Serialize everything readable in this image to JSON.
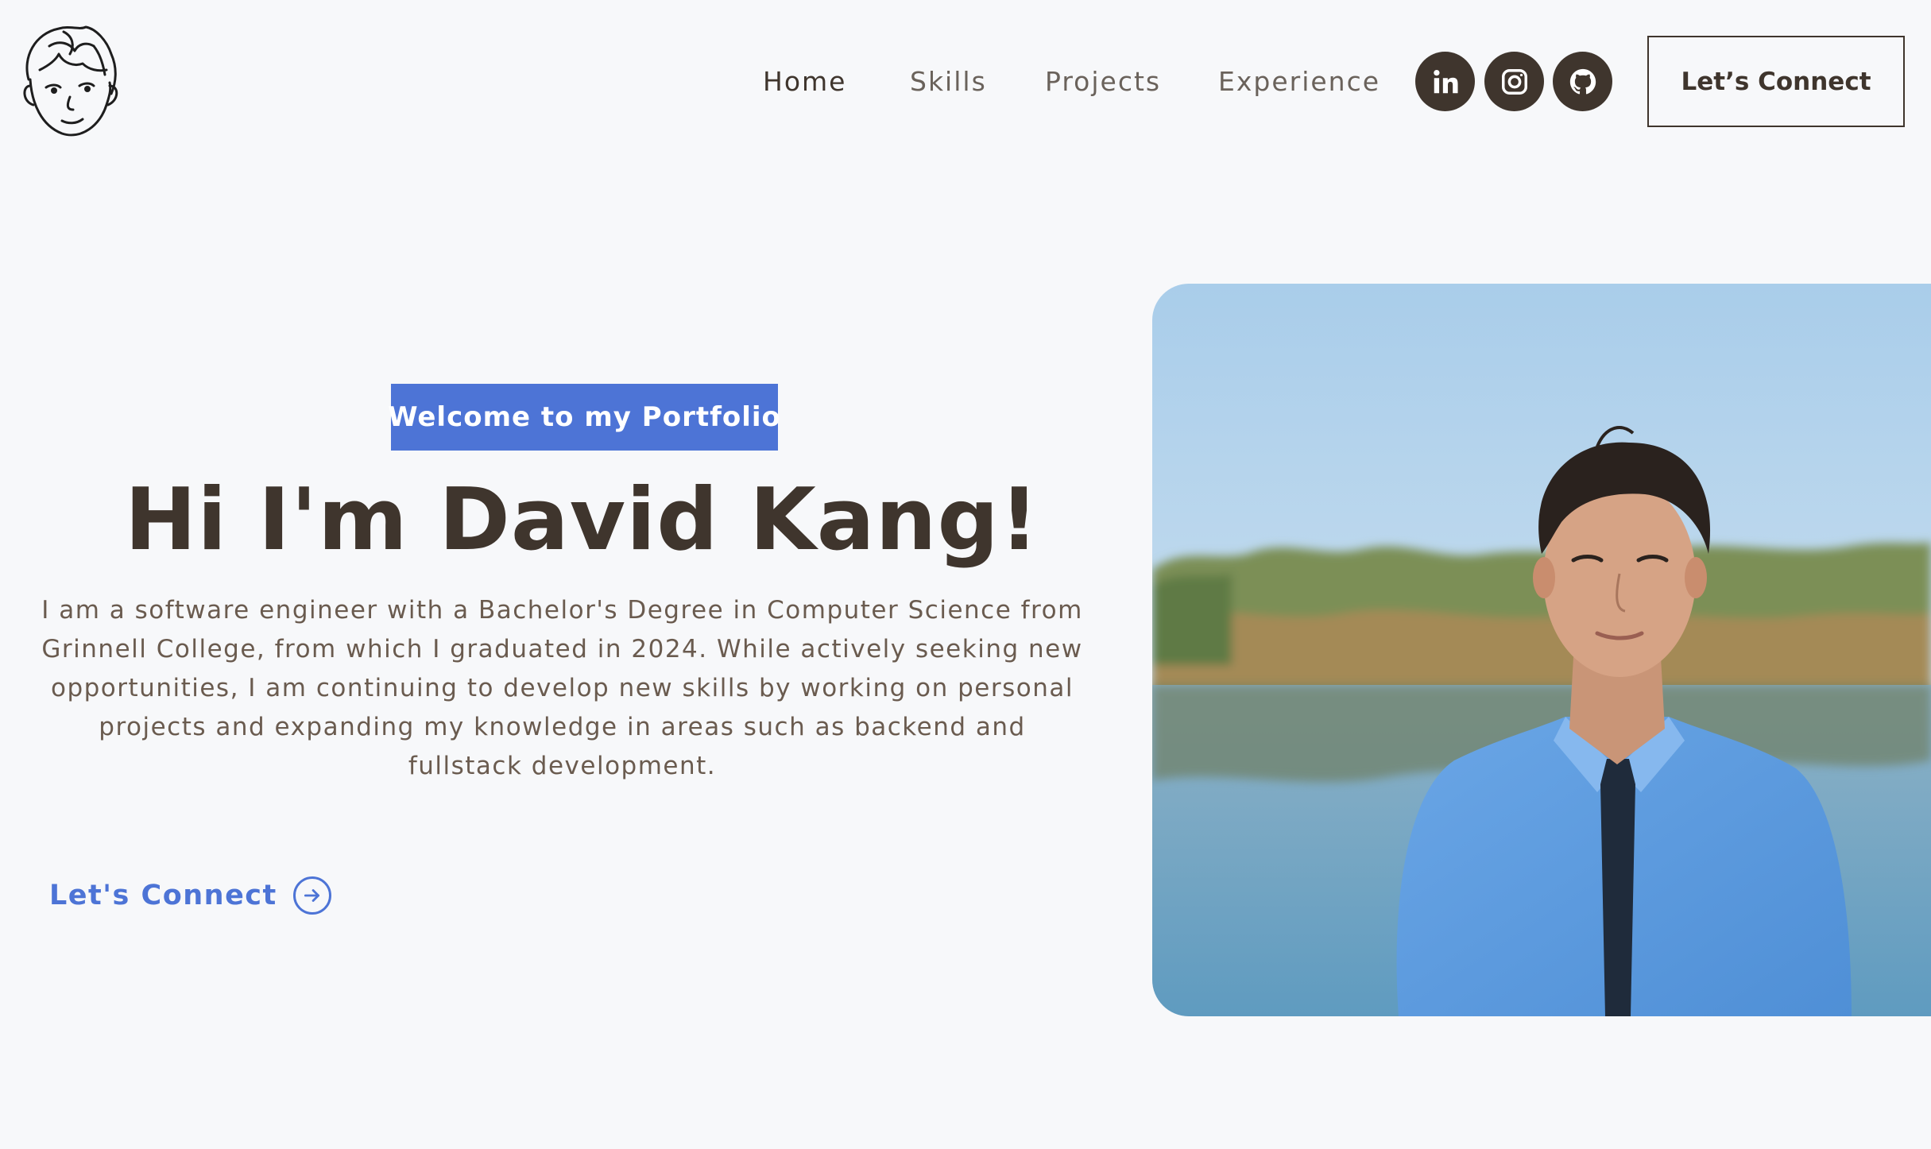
{
  "nav": {
    "links": [
      "Home",
      "Skills",
      "Projects",
      "Experience"
    ],
    "active": "Home",
    "socials": [
      "linkedin-icon",
      "instagram-icon",
      "github-icon"
    ],
    "connect_label": "Let’s Connect"
  },
  "hero": {
    "tagline": "Welcome to my Portfolio",
    "title": "Hi I'm David Kang!",
    "description": "I am a software engineer with a Bachelor's Degree in Computer Science from Grinnell College, from which I graduated in 2024. While actively seeking new opportunities, I am continuing to develop new skills by working on personal projects and expanding my knowledge in areas such as backend and fullstack development.",
    "cta_label": "Let's Connect"
  },
  "colors": {
    "background": "#f7f8fa",
    "text_dark": "#3f352d",
    "accent": "#4d74d6"
  }
}
